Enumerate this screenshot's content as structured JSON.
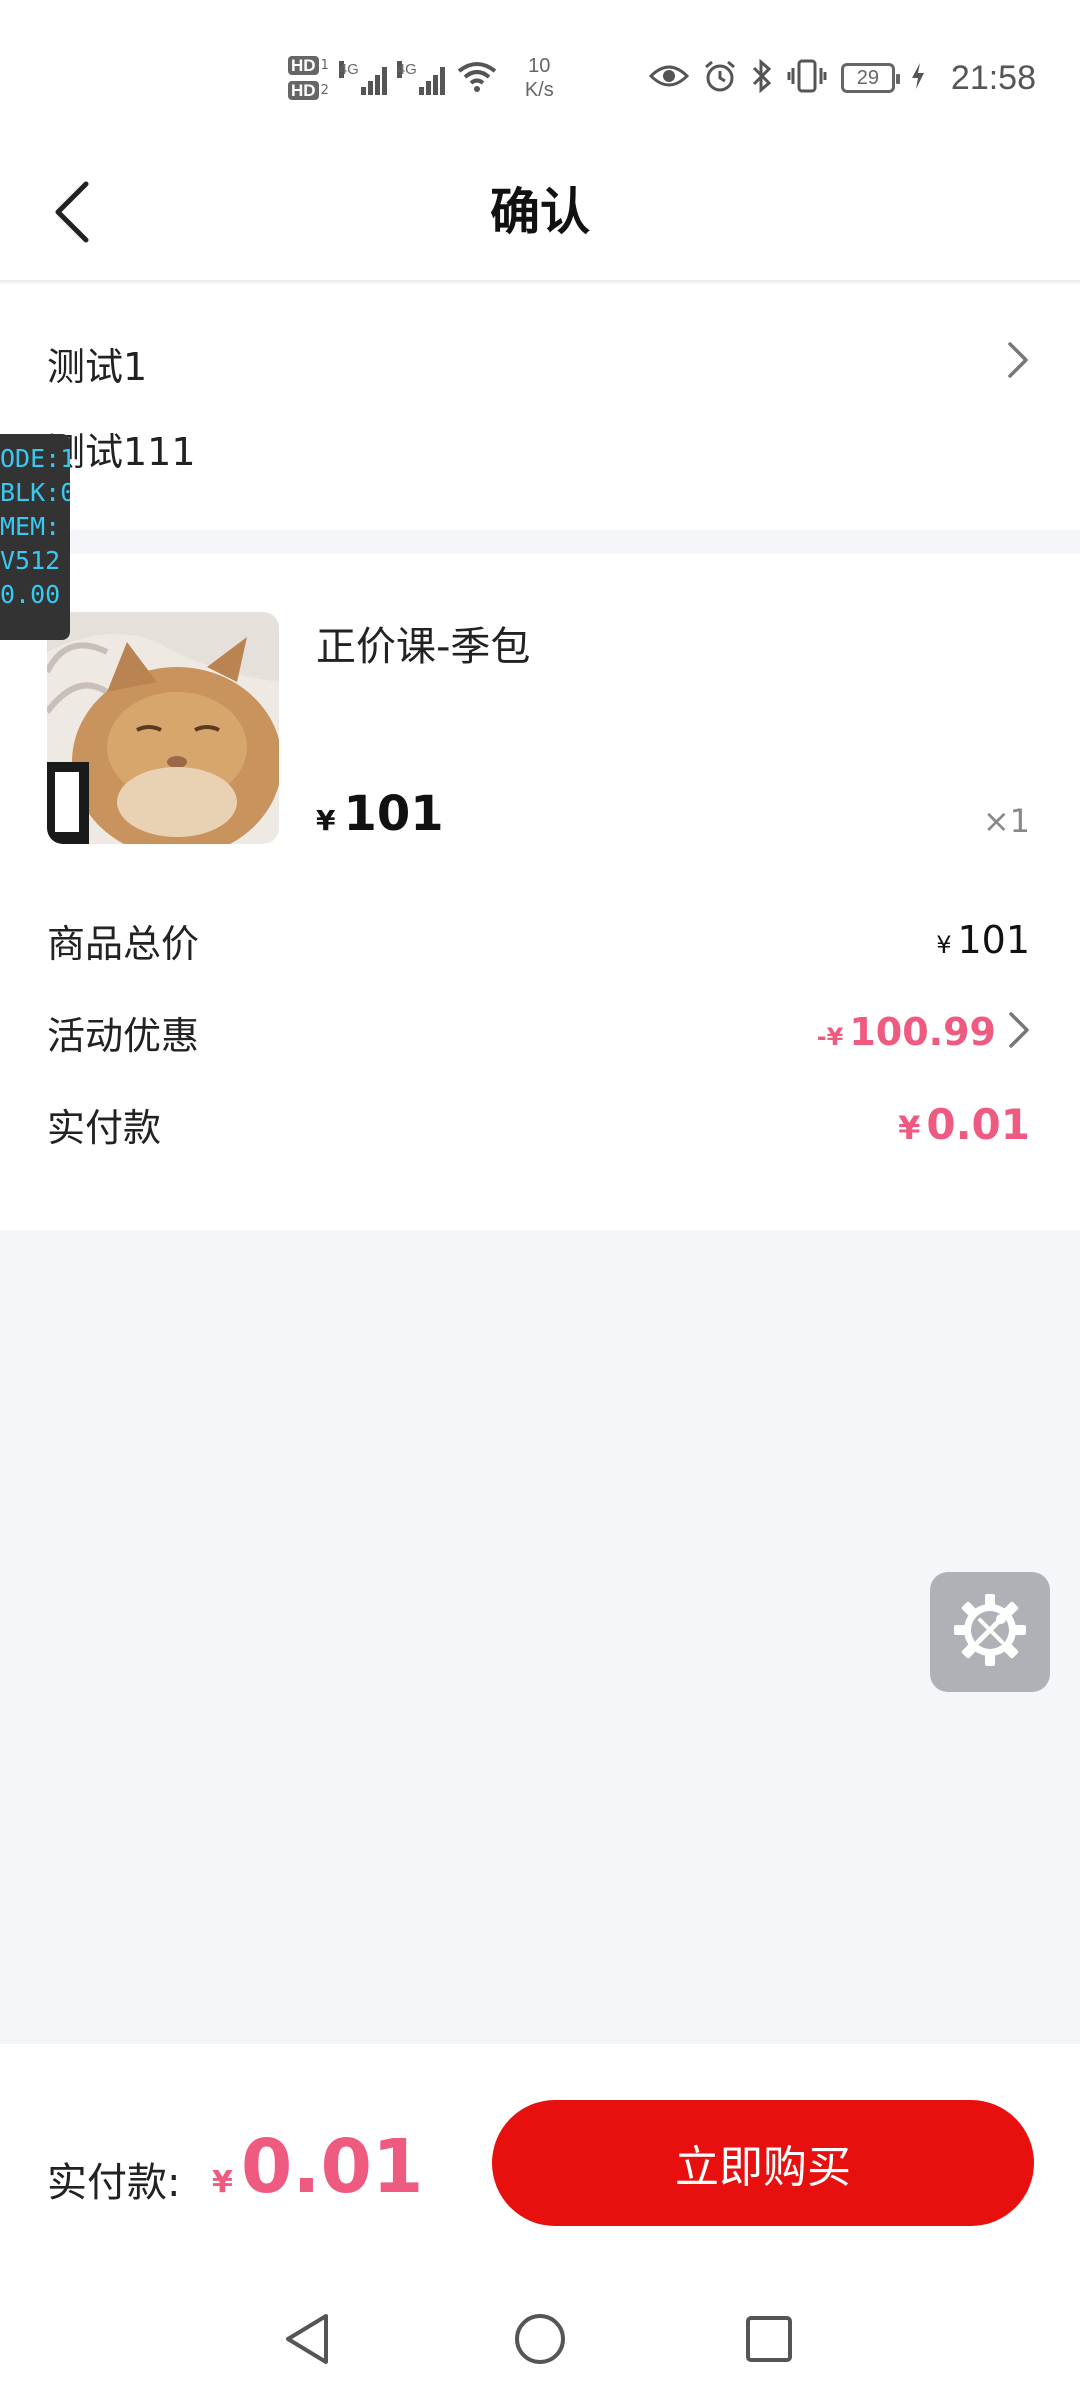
{
  "status_bar": {
    "hd1": "HD",
    "hd1_sub": "1",
    "hd2": "HD",
    "hd2_sub": "2",
    "net1": "4G",
    "net2": "4G",
    "speed_value": "10",
    "speed_unit": "K/s",
    "battery": "29",
    "time": "21:58",
    "icons": [
      "eye-icon",
      "alarm-icon",
      "bluetooth-icon",
      "vibrate-icon",
      "battery-icon",
      "charging-icon"
    ]
  },
  "header": {
    "title": "确认",
    "back_icon": "chevron-left-icon"
  },
  "address": {
    "line1": "测试1",
    "line2": "测试111"
  },
  "debug_overlay": {
    "lines": [
      "ODE:1",
      "BLK:0",
      "MEM:",
      "V512",
      "0.00"
    ]
  },
  "product": {
    "name": "正价课-季包",
    "currency": "¥",
    "price": "101",
    "quantity": "×1"
  },
  "summary": {
    "total_label": "商品总价",
    "total_currency": "¥",
    "total_value": "101",
    "discount_label": "活动优惠",
    "discount_prefix": "-¥",
    "discount_value": "100.99",
    "paid_label": "实付款",
    "paid_currency": "¥",
    "paid_value": "0.01"
  },
  "bottom_bar": {
    "label": "实付款:",
    "currency": "¥",
    "amount": "0.01",
    "buy_label": "立即购买"
  },
  "colors": {
    "accent_pink": "#ef5b80",
    "buy_red": "#e8100f",
    "background": "#f4f6f9"
  }
}
